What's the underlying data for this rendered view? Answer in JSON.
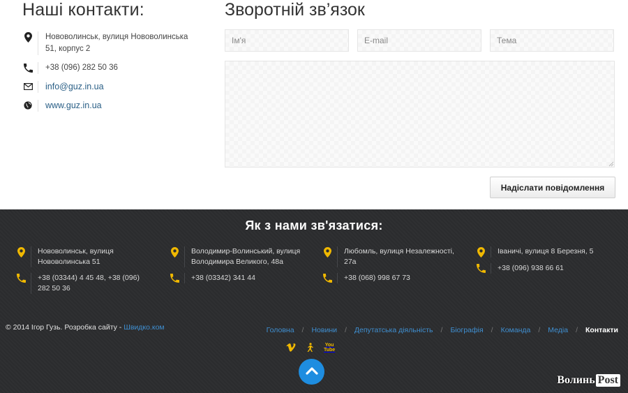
{
  "contacts": {
    "title": "Наші контакти:",
    "address": "Нововолинськ, вулиця Нововолинська 51, корпус 2",
    "phone": "+38 (096) 282 50 36",
    "email": "info@guz.in.ua",
    "website": "www.guz.in.ua"
  },
  "feedback": {
    "title": "Зворотній зв’язок",
    "name_placeholder": "Ім'я",
    "email_placeholder": "E-mail",
    "subject_placeholder": "Тема",
    "message_placeholder": "",
    "send_label": "Надіслати повідомлення"
  },
  "footer": {
    "title": "Як з нами зв'язатися:",
    "offices": [
      {
        "address": "Нововолинськ, вулиця Нововолинська 51",
        "phone": "+38 (03344) 4 45 48, +38 (096) 282 50 36"
      },
      {
        "address": "Володимир-Волинський, вулиця Володимира Великого, 48а",
        "phone": "+38 (03342) 341 44"
      },
      {
        "address": "Любомль, вулиця Незалежності, 27а",
        "phone": "+38 (068) 998 67 73"
      },
      {
        "address": "Іваничі, вулиця 8 Березня, 5",
        "phone": "+38 (096) 938 66 61"
      }
    ],
    "copyright_text": "© 2014 Ігор Гузь. Розробка сайту - ",
    "copyright_link": "Швидко.ком",
    "menu": [
      "Головна",
      "Новини",
      "Депутатська діяльність",
      "Біографія",
      "Команда",
      "Медіа",
      "Контакти"
    ],
    "youtube_label_1": "You",
    "youtube_label_2": "Tube",
    "watermark_1": "Волинь",
    "watermark_2": "Post"
  },
  "colors": {
    "accent": "#1e8de0",
    "link": "#3f8fd1",
    "icon_yellow": "#f0b800",
    "footer_bg": "#2b2c2e"
  },
  "icons": [
    "map-pin-icon",
    "phone-icon",
    "envelope-icon",
    "globe-icon",
    "vimeo-icon",
    "walker-icon",
    "youtube-icon",
    "chevron-up-icon"
  ]
}
